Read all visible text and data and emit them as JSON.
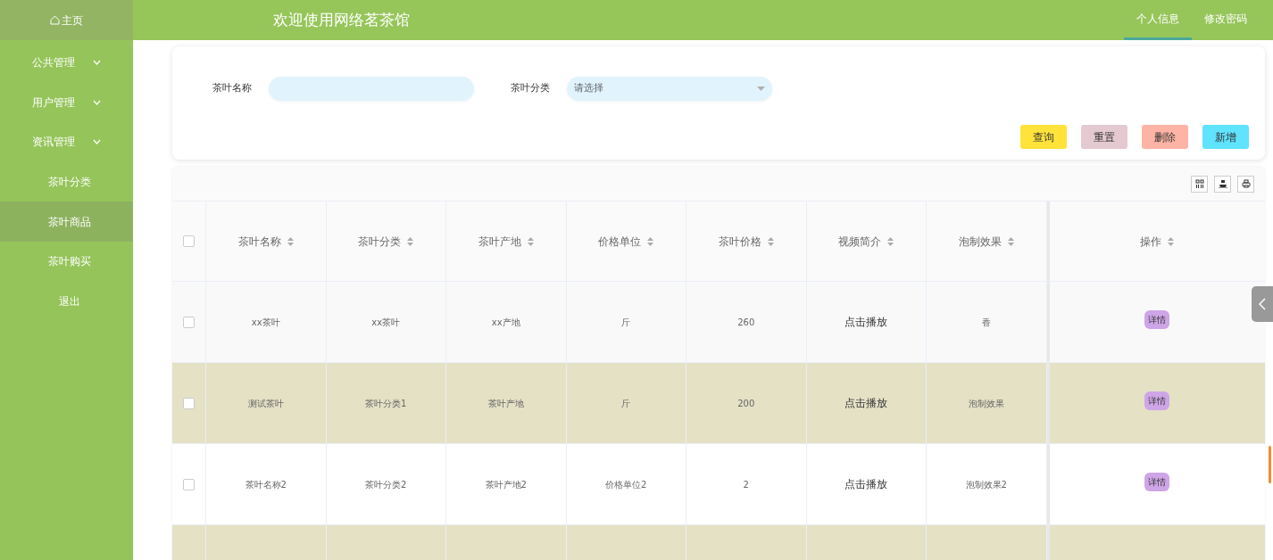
{
  "sidebar": {
    "home": "主页",
    "items": [
      {
        "label": "公共管理",
        "expandable": true,
        "selected": false
      },
      {
        "label": "用户管理",
        "expandable": true,
        "selected": false
      },
      {
        "label": "资讯管理",
        "expandable": true,
        "selected": false
      },
      {
        "label": "茶叶分类",
        "expandable": false,
        "selected": false
      },
      {
        "label": "茶叶商品",
        "expandable": false,
        "selected": true
      },
      {
        "label": "茶叶购买",
        "expandable": false,
        "selected": false
      },
      {
        "label": "退出",
        "expandable": false,
        "selected": false
      }
    ]
  },
  "header": {
    "title": "欢迎使用网络茗茶馆",
    "tabs": [
      {
        "label": "个人信息",
        "selected": true
      },
      {
        "label": "修改密码",
        "selected": false
      }
    ]
  },
  "search": {
    "fields": [
      {
        "kind": "text",
        "label": "茶叶名称"
      },
      {
        "kind": "select",
        "label": "茶叶分类",
        "placeholder": "请选择"
      }
    ],
    "buttons": [
      {
        "label": "查询",
        "color": "#ffe33a"
      },
      {
        "label": "重置",
        "color": "#e4c9d0"
      },
      {
        "label": "删除",
        "color": "#fdb4a4"
      },
      {
        "label": "新增",
        "color": "#5fe3fe"
      }
    ]
  },
  "table": {
    "select_all": {
      "checked": false
    },
    "columns": [
      "茶叶名称",
      "茶叶分类",
      "茶叶产地",
      "价格单位",
      "茶叶价格",
      "视频简介",
      "泡制效果",
      "操作"
    ],
    "rows": [
      {
        "checked": false,
        "cells": [
          "xx茶叶",
          "xx茶叶",
          "xx产地",
          "斤",
          "260"
        ],
        "video": "点击播放",
        "effect": "香",
        "action": "详情"
      },
      {
        "checked": false,
        "cells": [
          "测试茶叶",
          "茶叶分类1",
          "茶叶产地",
          "斤",
          "200"
        ],
        "video": "点击播放",
        "effect": "泡制效果",
        "action": "详情"
      },
      {
        "checked": false,
        "cells": [
          "茶叶名称2",
          "茶叶分类2",
          "茶叶产地2",
          "价格单位2",
          "2"
        ],
        "video": "点击播放",
        "effect": "泡制效果2",
        "action": "详情"
      }
    ]
  }
}
